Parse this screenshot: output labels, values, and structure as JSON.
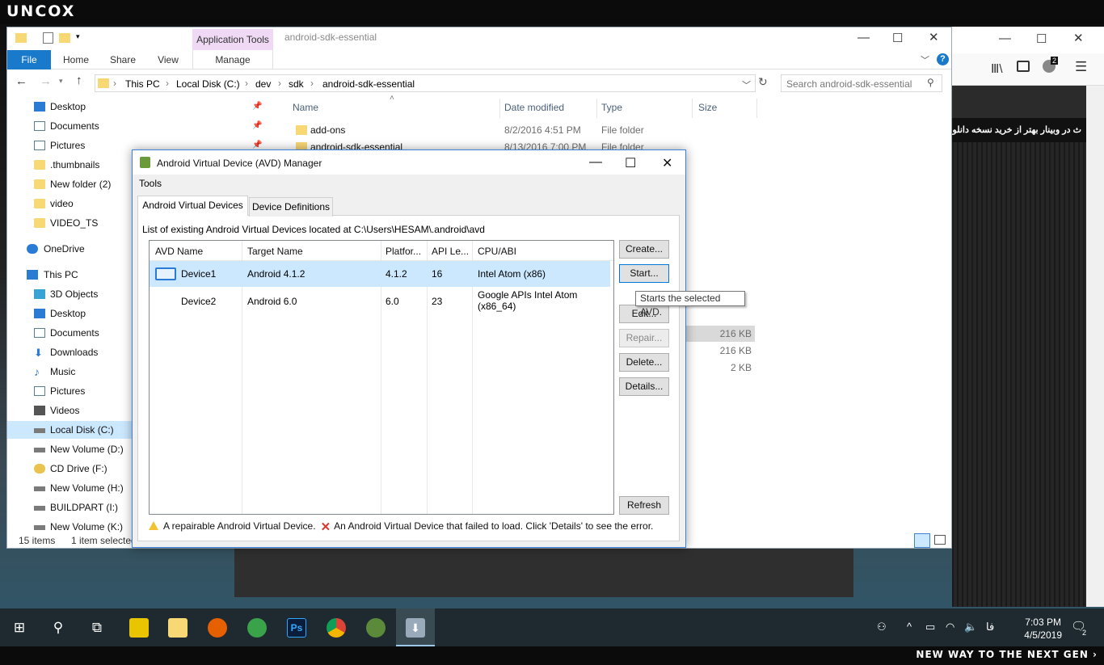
{
  "brand": {
    "logo": "UNCOX",
    "tagline": "NEW WAY TO THE NEXT GEN ›"
  },
  "browser": {
    "strip_text": "ث در وبینار بهتر از خرید نسخه دانلو",
    "badge_count": "2"
  },
  "explorer": {
    "window_title": "android-sdk-essential",
    "contextual_group": "Application Tools",
    "ribbon_tabs": {
      "file": "File",
      "home": "Home",
      "share": "Share",
      "view": "View",
      "manage": "Manage"
    },
    "breadcrumb": [
      "This PC",
      "Local Disk (C:)",
      "dev",
      "sdk",
      "android-sdk-essential"
    ],
    "search_placeholder": "Search android-sdk-essential",
    "nav_items": {
      "desktop": "Desktop",
      "documents": "Documents",
      "pictures": "Pictures",
      "thumbnails": ".thumbnails",
      "new_folder": "New folder (2)",
      "video": "video",
      "video_ts": "VIDEO_TS",
      "onedrive": "OneDrive",
      "this_pc": "This PC",
      "objects_3d": "3D Objects",
      "desktop2": "Desktop",
      "documents2": "Documents",
      "downloads": "Downloads",
      "music": "Music",
      "pictures2": "Pictures",
      "videos": "Videos",
      "local_disk_c": "Local Disk (C:)",
      "new_volume_d": "New Volume (D:)",
      "cd_drive_f": "CD Drive (F:)",
      "new_volume_h": "New Volume (H:)",
      "buildpart_i": "BUILDPART (I:)",
      "new_volume_k": "New Volume (K:)"
    },
    "columns": {
      "name": "Name",
      "date": "Date modified",
      "type": "Type",
      "size": "Size"
    },
    "files": [
      {
        "name": "add-ons",
        "date": "8/2/2016 4:51 PM",
        "type": "File folder"
      },
      {
        "name": "android-sdk-essential",
        "date": "8/13/2016 7:00 PM",
        "type": "File folder"
      }
    ],
    "sizes": [
      "216 KB",
      "216 KB",
      "2 KB"
    ],
    "status": {
      "items": "15 items",
      "selected": "1 item selected"
    }
  },
  "avd": {
    "title": "Android Virtual Device (AVD) Manager",
    "menu_tools": "Tools",
    "tabs": {
      "devices": "Android Virtual Devices",
      "definitions": "Device Definitions"
    },
    "path_label": "List of existing Android Virtual Devices located at C:\\Users\\HESAM\\.android\\avd",
    "columns": {
      "name": "AVD Name",
      "target": "Target Name",
      "platform": "Platfor...",
      "api": "API Le...",
      "cpu": "CPU/ABI"
    },
    "rows": [
      {
        "name": "Device1",
        "target": "Android 4.1.2",
        "platform": "4.1.2",
        "api": "16",
        "cpu": "Intel Atom (x86)"
      },
      {
        "name": "Device2",
        "target": "Android 6.0",
        "platform": "6.0",
        "api": "23",
        "cpu": "Google APIs Intel Atom (x86_64)"
      }
    ],
    "buttons": {
      "create": "Create...",
      "start": "Start...",
      "edit": "Edit...",
      "repair": "Repair...",
      "delete": "Delete...",
      "details": "Details...",
      "refresh": "Refresh"
    },
    "tooltip": "Starts the selected AVD.",
    "legend_repairable": "A repairable Android Virtual Device.",
    "legend_failed": "An Android Virtual Device that failed to load. Click 'Details' to see the error."
  },
  "taskbar": {
    "time": "7:03 PM",
    "date": "4/5/2019",
    "lang": "فا",
    "notifications": "2"
  }
}
